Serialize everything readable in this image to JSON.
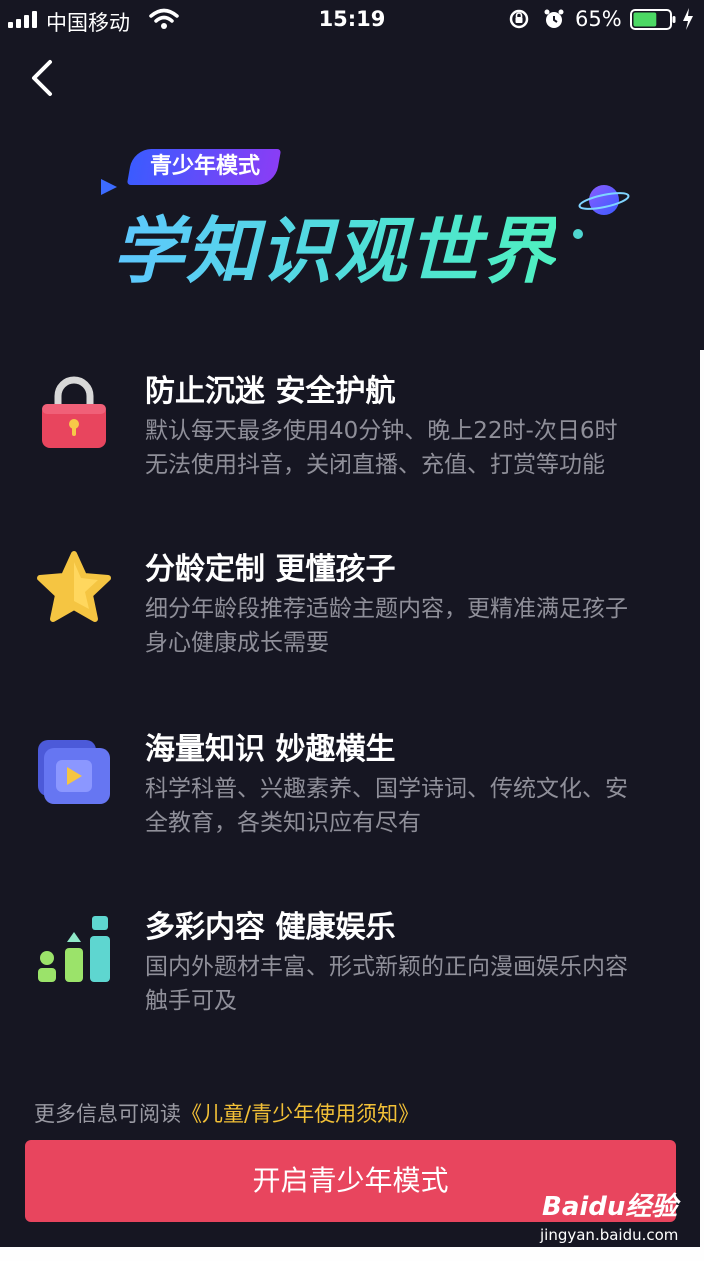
{
  "status_bar": {
    "carrier": "中国移动",
    "time": "15:19",
    "battery_percent": "65%",
    "battery_level": 0.65
  },
  "nav": {
    "back_icon": "chevron-left-icon"
  },
  "hero": {
    "badge": "青少年模式",
    "title": "学知识观世界"
  },
  "features": [
    {
      "icon": "lock-icon",
      "title": "防止沉迷 安全护航",
      "lines": [
        "默认每天最多使用40分钟、晚上22时-次日6时",
        "无法使用抖音，关闭直播、充值、打赏等功能"
      ]
    },
    {
      "icon": "star-icon",
      "title": "分龄定制 更懂孩子",
      "lines": [
        "细分年龄段推荐适龄主题内容，更精准满足孩子",
        "身心健康成长需要"
      ]
    },
    {
      "icon": "video-folder-icon",
      "title": "海量知识 妙趣横生",
      "lines": [
        "科学科普、兴趣素养、国学诗词、传统文化、安",
        "全教育，各类知识应有尽有"
      ]
    },
    {
      "icon": "bar-chart-icon",
      "title": "多彩内容 健康娱乐",
      "lines": [
        "国内外题材丰富、形式新颖的正向漫画娱乐内容",
        "触手可及"
      ]
    }
  ],
  "info": {
    "prefix": "更多信息可阅读",
    "link": "《儿童/青少年使用须知》"
  },
  "cta": {
    "label": "开启青少年模式"
  },
  "watermark": {
    "brand": "Baidu经验",
    "site": "jingyan.baidu.com"
  },
  "colors": {
    "background": "#161622",
    "accent": "#e8455e",
    "link": "#f2c037"
  }
}
